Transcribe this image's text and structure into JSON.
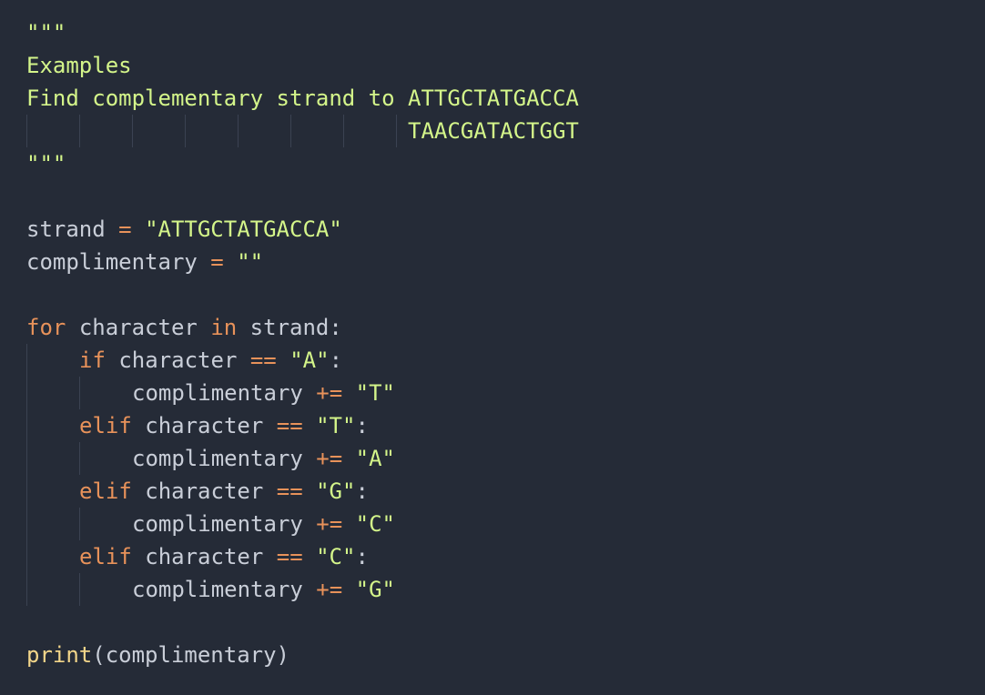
{
  "colors": {
    "background": "#252b37",
    "identifier": "#c9ced8",
    "operator": "#e8925a",
    "keyword": "#e8925a",
    "string": "#d4f58a",
    "function": "#f3d68a",
    "indent_guide": "#3b4252"
  },
  "code": {
    "docstring_open": "\"\"\"",
    "doc_line1": "Examples",
    "doc_line2": "Find complementary strand to ATTGCTATGACCA",
    "doc_line3": "TAACGATACTGGT",
    "docstring_close": "\"\"\"",
    "line_strand": {
      "name": "strand",
      "op": "=",
      "value": "\"ATTGCTATGACCA\""
    },
    "line_compl": {
      "name": "complimentary",
      "op": "=",
      "value": "\"\""
    },
    "for_line": {
      "kw_for": "for",
      "var": "character",
      "kw_in": "in",
      "iter": "strand",
      "colon": ":"
    },
    "branches": [
      {
        "kw": "if",
        "var": "character",
        "op": "==",
        "cmp": "\"A\"",
        "colon": ":",
        "target": "complimentary",
        "aug_op": "+=",
        "value": "\"T\""
      },
      {
        "kw": "elif",
        "var": "character",
        "op": "==",
        "cmp": "\"T\"",
        "colon": ":",
        "target": "complimentary",
        "aug_op": "+=",
        "value": "\"A\""
      },
      {
        "kw": "elif",
        "var": "character",
        "op": "==",
        "cmp": "\"G\"",
        "colon": ":",
        "target": "complimentary",
        "aug_op": "+=",
        "value": "\"C\""
      },
      {
        "kw": "elif",
        "var": "character",
        "op": "==",
        "cmp": "\"C\"",
        "colon": ":",
        "target": "complimentary",
        "aug_op": "+=",
        "value": "\"G\""
      }
    ],
    "print_line": {
      "fn": "print",
      "open": "(",
      "arg": "complimentary",
      "close": ")"
    }
  }
}
